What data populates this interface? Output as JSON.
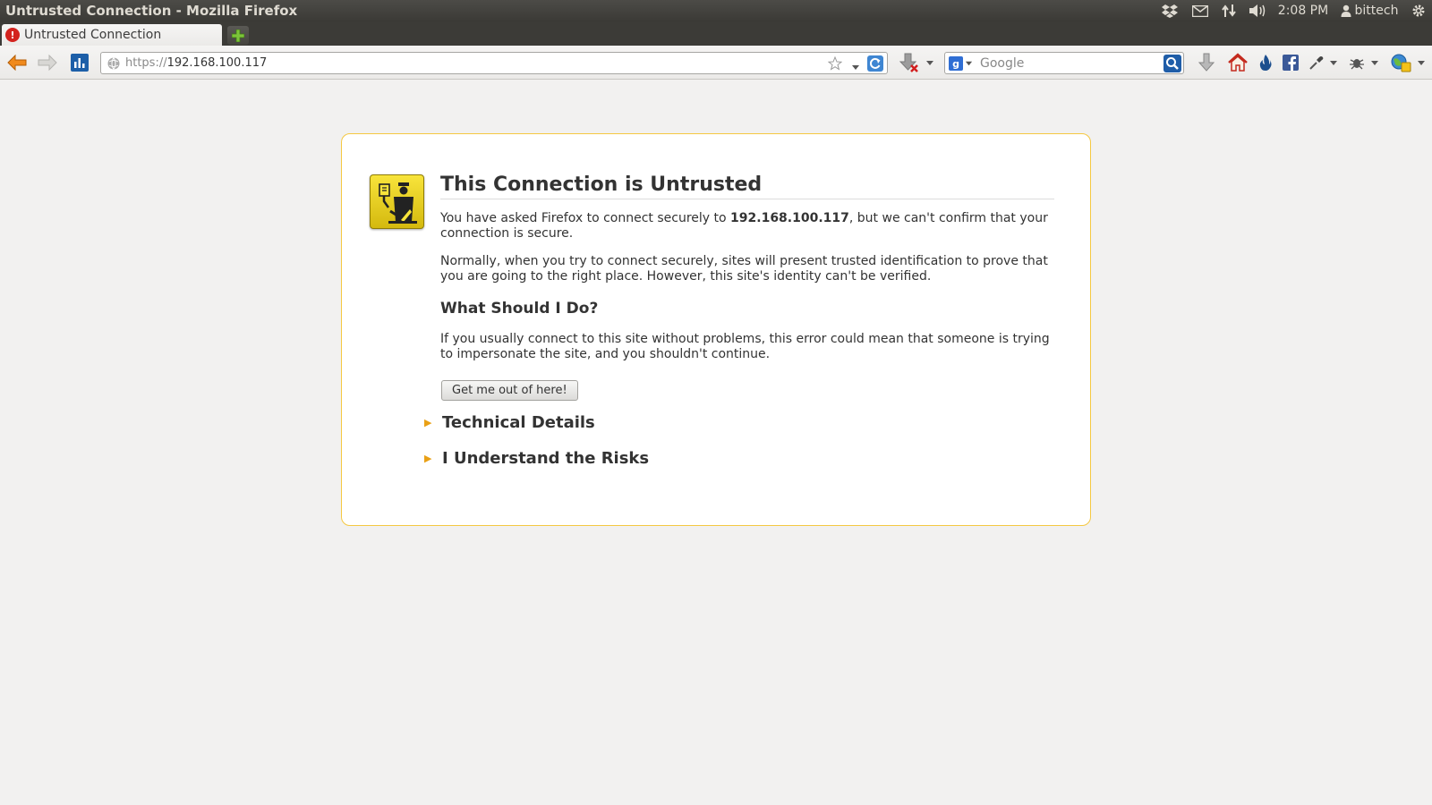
{
  "window": {
    "title": "Untrusted Connection - Mozilla Firefox"
  },
  "system": {
    "clock": "2:08 PM",
    "user": "bittech"
  },
  "tabs": [
    {
      "label": "Untrusted Connection",
      "active": true
    }
  ],
  "navbar": {
    "url_scheme": "https://",
    "url_host": "192.168.100.117",
    "search_placeholder": "Google"
  },
  "error_page": {
    "title": "This Connection is Untrusted",
    "para1_before": "You have asked Firefox to connect securely to ",
    "para1_host": "192.168.100.117",
    "para1_after": ", but we can't confirm that your connection is secure.",
    "para2": "Normally, when you try to connect securely, sites will present trusted identification to prove that you are going to the right place. However, this site's identity can't be verified.",
    "what_heading": "What Should I Do?",
    "para3": "If you usually connect to this site without problems, this error could mean that someone is trying to impersonate the site, and you shouldn't continue.",
    "getout_label": "Get me out of here!",
    "technical_label": "Technical Details",
    "risks_label": "I Understand the Risks"
  },
  "colors": {
    "accent_border": "#f5c842",
    "expander_triangle": "#e9a015",
    "tab_error": "#d3231e"
  }
}
